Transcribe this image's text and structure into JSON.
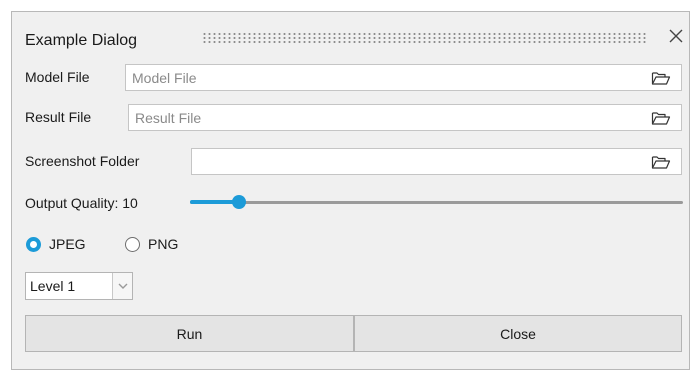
{
  "dialog": {
    "title": "Example Dialog",
    "close_icon": "close-icon"
  },
  "model_file": {
    "label": "Model File",
    "placeholder": "Model File",
    "value": "",
    "icon": "folder-open-icon"
  },
  "result_file": {
    "label": "Result File",
    "placeholder": "Result File",
    "value": "",
    "icon": "folder-open-icon"
  },
  "screenshot_folder": {
    "label": "Screenshot Folder",
    "placeholder": "",
    "value": "",
    "icon": "folder-open-icon"
  },
  "output_quality": {
    "label": "Output Quality: 10",
    "value": 10,
    "min": 0,
    "max": 100
  },
  "format": {
    "options": [
      "JPEG",
      "PNG"
    ],
    "selected": "JPEG"
  },
  "level": {
    "selected": "Level 1",
    "icon": "chevron-down-icon"
  },
  "buttons": {
    "run": "Run",
    "close": "Close"
  },
  "colors": {
    "accent": "#1c9bd8",
    "dialog_bg": "#f0f0f0",
    "button_bg": "#e4e4e4"
  }
}
